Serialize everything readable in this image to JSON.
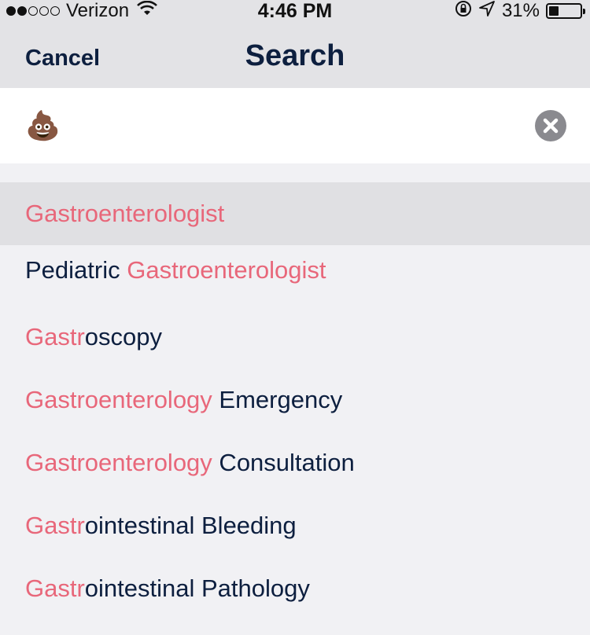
{
  "status_bar": {
    "carrier": "Verizon",
    "time": "4:46 PM",
    "battery_text": "31%",
    "battery_level": 0.31,
    "icons": [
      "signal-dots-icon",
      "wifi-icon",
      "rotation-lock-icon",
      "location-arrow-icon",
      "battery-icon"
    ]
  },
  "nav": {
    "cancel_label": "Cancel",
    "title": "Search"
  },
  "search": {
    "value": "💩",
    "clear_icon": "clear-circle-icon"
  },
  "results": [
    {
      "match": "Gastroenterologist",
      "rest": "",
      "prefix": "",
      "selected": true
    },
    {
      "prefix": "Pediatric ",
      "match": "Gastroenterologist",
      "rest": ""
    },
    {
      "prefix": "",
      "match": "Gastr",
      "rest": "oscopy"
    },
    {
      "prefix": "",
      "match": "Gastroenterology",
      "rest": " Emergency"
    },
    {
      "prefix": "",
      "match": "Gastroenterology",
      "rest": " Consultation"
    },
    {
      "prefix": "",
      "match": "Gastr",
      "rest": "ointestinal Bleeding"
    },
    {
      "prefix": "",
      "match": "Gastr",
      "rest": "ointestinal Pathology"
    }
  ],
  "colors": {
    "match_highlight": "#e8677a",
    "text_dark": "#0d1f3f",
    "selected_row": "#e0e0e3"
  }
}
